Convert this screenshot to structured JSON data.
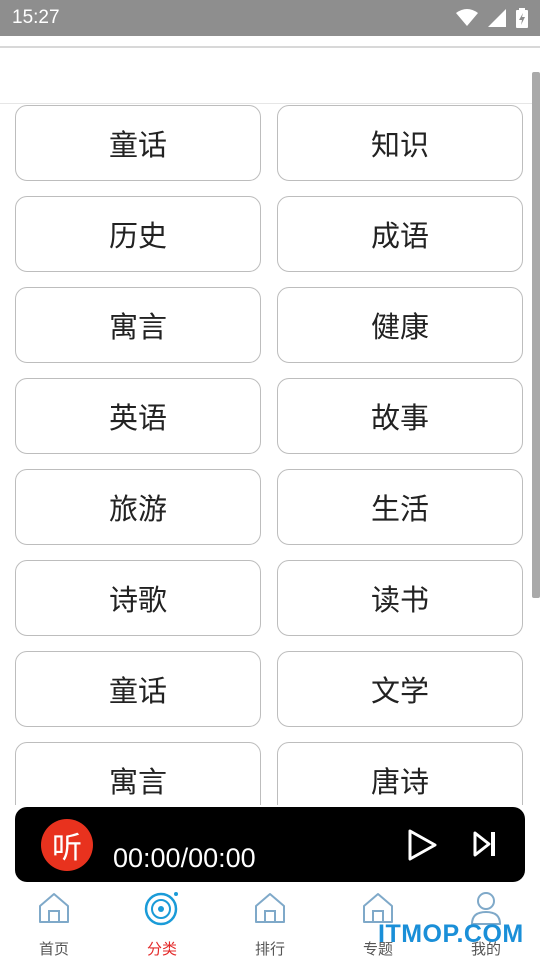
{
  "status_bar": {
    "time": "15:27"
  },
  "categories": [
    {
      "label": "童话"
    },
    {
      "label": "知识"
    },
    {
      "label": "历史"
    },
    {
      "label": "成语"
    },
    {
      "label": "寓言"
    },
    {
      "label": "健康"
    },
    {
      "label": "英语"
    },
    {
      "label": "故事"
    },
    {
      "label": "旅游"
    },
    {
      "label": "生活"
    },
    {
      "label": "诗歌"
    },
    {
      "label": "读书"
    },
    {
      "label": "童话"
    },
    {
      "label": "文学"
    },
    {
      "label": "寓言"
    },
    {
      "label": "唐诗"
    }
  ],
  "player": {
    "logo_text": "听",
    "time": "00:00/00:00"
  },
  "nav": {
    "items": [
      {
        "label": "首页",
        "icon": "home-icon"
      },
      {
        "label": "分类",
        "icon": "disc-icon",
        "active": true
      },
      {
        "label": "排行",
        "icon": "home-icon"
      },
      {
        "label": "专题",
        "icon": "home-icon"
      },
      {
        "label": "我的",
        "icon": "user-icon"
      }
    ]
  },
  "watermark": "ITMOP.COM",
  "colors": {
    "accent": "#e32a2a",
    "player_bg": "#000000",
    "logo_red": "#e8321e",
    "watermark": "#1a8fd8"
  }
}
